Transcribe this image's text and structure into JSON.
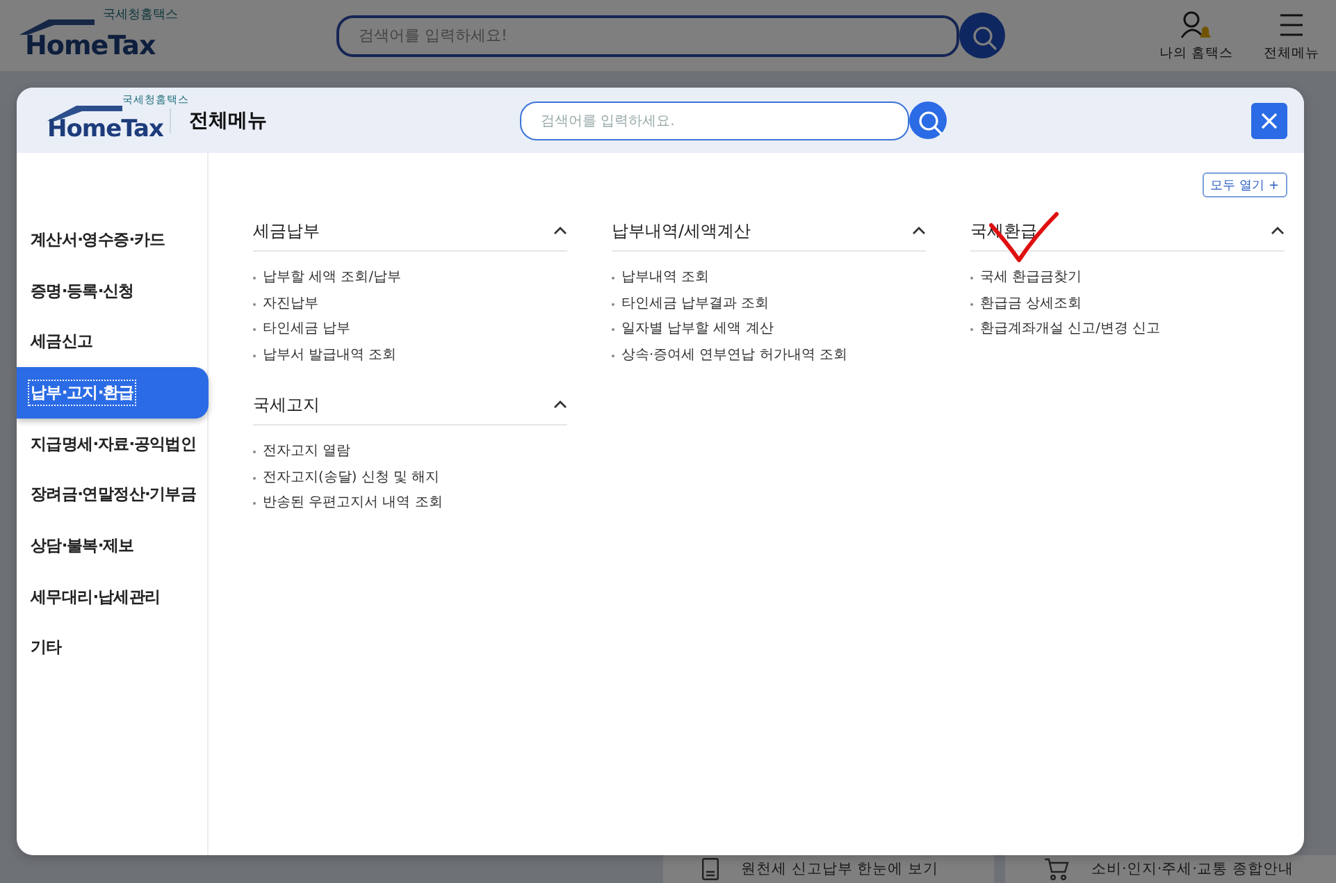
{
  "background": {
    "logo": {
      "small": "국세청홈택스",
      "name": "HomeTax"
    },
    "search": {
      "placeholder": "검색어를 입력하세요!"
    },
    "actions": [
      {
        "label": "나의 홈택스",
        "kind": "user"
      },
      {
        "label": "전체메뉴",
        "kind": "menu"
      }
    ],
    "cards": [
      {
        "text": "원천세 신고납부 한눈에 보기",
        "kind": "document"
      },
      {
        "text": "소비·인지·주세·교통 종합안내",
        "kind": "cart"
      }
    ]
  },
  "menu": {
    "logo": {
      "small": "국세청홈택스",
      "name": "HomeTax"
    },
    "title": "전체메뉴",
    "search": {
      "placeholder": "검색어를 입력하세요."
    },
    "expand_all": "모두 열기 +",
    "sidebar": {
      "items": [
        {
          "label": "계산서·영수증·카드",
          "selected": false
        },
        {
          "label": "증명·등록·신청",
          "selected": false
        },
        {
          "label": "세금신고",
          "selected": false
        },
        {
          "label": "납부·고지·환급",
          "selected": true
        },
        {
          "label": "지급명세·자료·공익법인",
          "selected": false
        },
        {
          "label": "장려금·연말정산·기부금",
          "selected": false
        },
        {
          "label": "상담·불복·제보",
          "selected": false
        },
        {
          "label": "세무대리·납세관리",
          "selected": false
        },
        {
          "label": "기타",
          "selected": false
        }
      ]
    },
    "columns": [
      {
        "groups": [
          {
            "title": "세금납부",
            "expanded": true,
            "items": [
              "납부할 세액 조회/납부",
              "자진납부",
              "타인세금 납부",
              "납부서 발급내역 조회"
            ]
          },
          {
            "title": "국세고지",
            "expanded": true,
            "items": [
              "전자고지 열람",
              "전자고지(송달) 신청 및 해지",
              "반송된 우편고지서 내역 조회"
            ]
          }
        ]
      },
      {
        "groups": [
          {
            "title": "납부내역/세액계산",
            "expanded": true,
            "items": [
              "납부내역 조회",
              "타인세금 납부결과 조회",
              "일자별 납부할 세액 계산",
              "상속·증여세 연부연납 허가내역 조회"
            ]
          }
        ]
      },
      {
        "groups": [
          {
            "title": "국세환급",
            "expanded": true,
            "items": [
              "국세 환급금찾기",
              "환급금 상세조회",
              "환급계좌개설 신고/변경 신고"
            ]
          }
        ]
      }
    ]
  }
}
